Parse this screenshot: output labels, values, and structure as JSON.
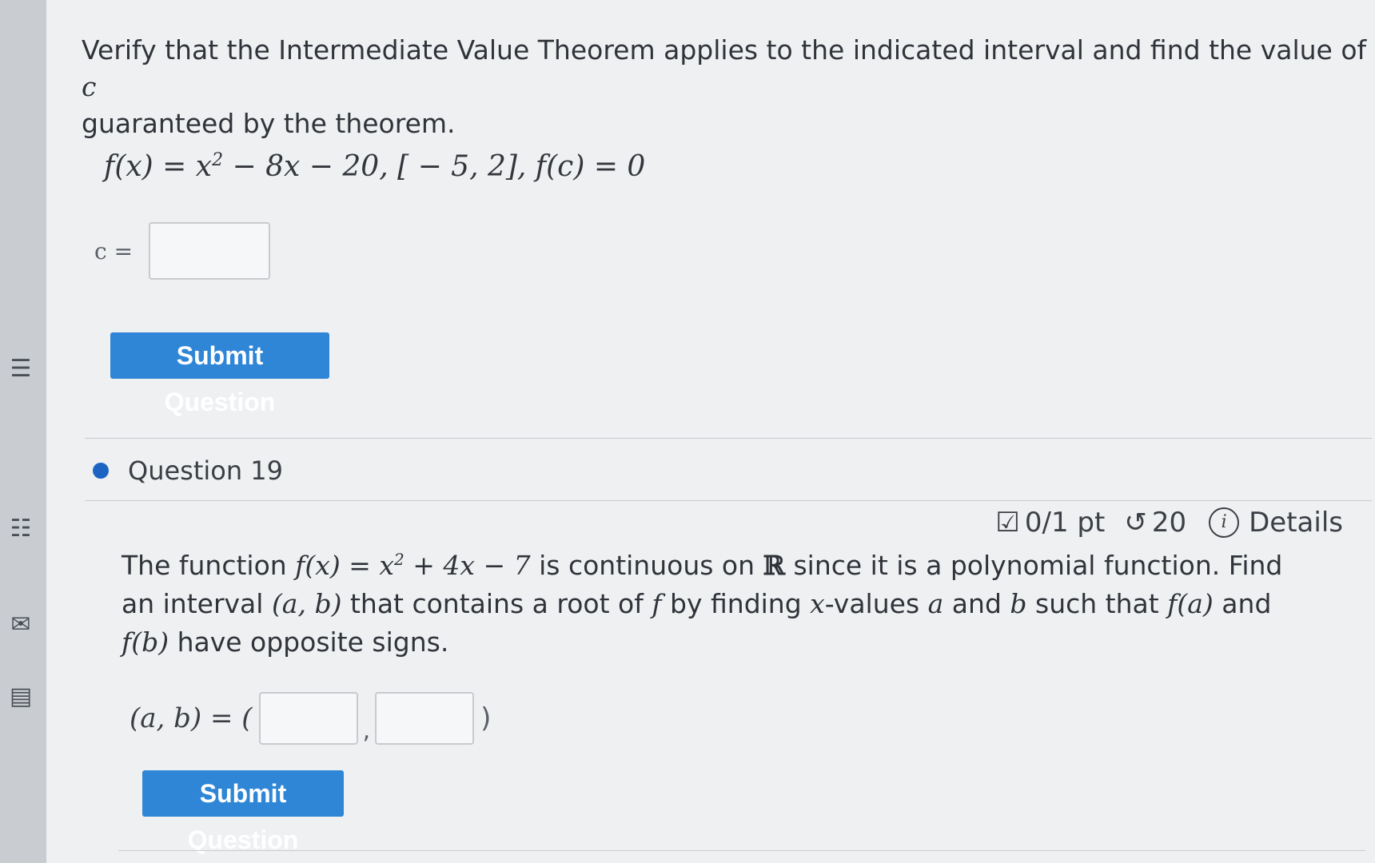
{
  "sidebar": {
    "icons": [
      "mail-icon",
      "notebook-icon",
      "grid-icon",
      "list-icon"
    ]
  },
  "question18": {
    "prompt_part1": "Verify that the Intermediate Value Theorem applies to the indicated interval and find the value of ",
    "prompt_var": "c",
    "prompt_part2": "guaranteed by the theorem.",
    "equation": {
      "lhs": "f(x) = x",
      "exp": "2",
      "rest": " − 8x − 20, [ − 5, 2], f(c) = 0"
    },
    "answer_label": "c =",
    "answer_value": "",
    "submit_label": "Submit Question"
  },
  "question19": {
    "title": "Question 19",
    "score": "0/1 pt",
    "attempts": "20",
    "details_label": "Details",
    "text": {
      "p1": "The function ",
      "fx": "f(x) = x",
      "exp": "2",
      "poly": " + 4x − 7",
      "p2": " is continuous on ",
      "reals": "ℝ",
      "p3": " since it is a polynomial function. Find an interval ",
      "interval": "(a, b)",
      "p4": " that contains a root of ",
      "f": "f",
      "p5": " by finding ",
      "x": "x",
      "p6": "-values ",
      "a": "a",
      "p7": " and ",
      "b": "b",
      "p8": " such that ",
      "fa": "f(a)",
      "p9": " and ",
      "fb": "f(b)",
      "p10": " have opposite signs."
    },
    "ab_label": "(a, b) = (",
    "a_value": "",
    "b_value": "",
    "ab_comma": ",",
    "ab_close": ")",
    "submit_label": "Submit Question"
  }
}
